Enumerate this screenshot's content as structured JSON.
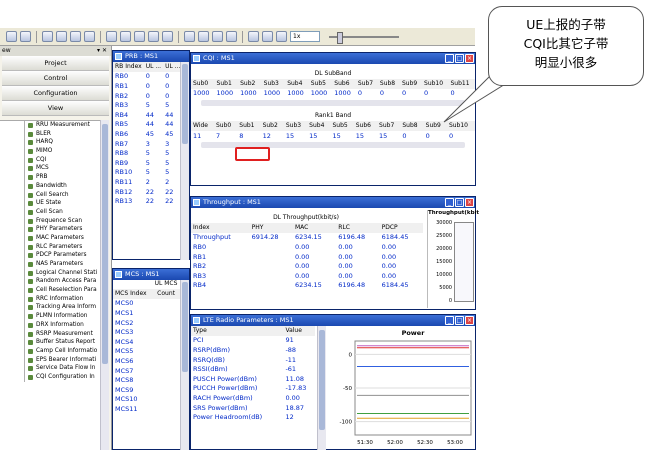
{
  "left_panel": {
    "header": "ew",
    "header_ctrl": "▾ ✕",
    "buttons": [
      "Project",
      "Control",
      "Configuration",
      "View"
    ],
    "tree": [
      "RRU Measurement",
      "BLER",
      "HARQ",
      "MIMO",
      "CQI",
      "MCS",
      "PRB",
      "Bandwidth",
      "Cell Search",
      "UE State",
      "Cell Scan",
      "Frequence Scan",
      "PHY Parameters",
      "MAC Parameters",
      "RLC Parameters",
      "PDCP Parameters",
      "NAS Parameters",
      "Logical Channel Stati",
      "Random Access Para",
      "Cell Reselection Para",
      "RRC Information",
      "Tracking Area Inform",
      "PLMN Information",
      "DRX Information",
      "RSRP Measurement",
      "Buffer Status Report",
      "Camp Cell Informatio",
      "EPS Bearer Informati",
      "Service Data Flow In",
      "CQI Configuration In"
    ]
  },
  "toolbar": {
    "zoom": "1x"
  },
  "prb": {
    "title": "PRB : MS1",
    "headers": [
      "RB Index",
      "UL ...",
      "UL ..."
    ],
    "rows": [
      [
        "RB0",
        "0",
        "0"
      ],
      [
        "RB1",
        "0",
        "0"
      ],
      [
        "RB2",
        "0",
        "0"
      ],
      [
        "RB3",
        "5",
        "5"
      ],
      [
        "RB4",
        "44",
        "44"
      ],
      [
        "RB5",
        "44",
        "44"
      ],
      [
        "RB6",
        "45",
        "45"
      ],
      [
        "RB7",
        "3",
        "3"
      ],
      [
        "RB8",
        "5",
        "5"
      ],
      [
        "RB9",
        "5",
        "5"
      ],
      [
        "RB10",
        "5",
        "5"
      ],
      [
        "RB11",
        "2",
        "2"
      ],
      [
        "RB12",
        "22",
        "22"
      ],
      [
        "RB13",
        "22",
        "22"
      ]
    ]
  },
  "mcs": {
    "title": "MCS : MS1",
    "group": "UL MCS",
    "headers": [
      "MCS Index",
      "Count"
    ],
    "rows": [
      "MCS0",
      "MCS1",
      "MCS2",
      "MCS3",
      "MCS4",
      "MCS5",
      "MCS6",
      "MCS7",
      "MCS8",
      "MCS9",
      "MCS10",
      "MCS11"
    ]
  },
  "cqi": {
    "title": "CQI : MS1",
    "subband_title": "DL SubBand",
    "sub_headers": [
      "Sub0",
      "Sub1",
      "Sub2",
      "Sub3",
      "Sub4",
      "Sub5",
      "Sub6",
      "Sub7",
      "Sub8",
      "Sub9",
      "Sub10",
      "Sub11"
    ],
    "sub_values": [
      "1000",
      "1000",
      "1000",
      "1000",
      "1000",
      "1000",
      "1000",
      "0",
      "0",
      "0",
      "0",
      "0"
    ],
    "rank_title": "Rank1 Band",
    "rank_headers": [
      "Wide",
      "Sub0",
      "Sub1",
      "Sub2",
      "Sub3",
      "Sub4",
      "Sub5",
      "Sub6",
      "Sub7",
      "Sub8",
      "Sub9",
      "Sub10"
    ],
    "rank_values": [
      "11",
      "7",
      "8",
      "12",
      "15",
      "15",
      "15",
      "15",
      "15",
      "0",
      "0",
      "0"
    ]
  },
  "throughput": {
    "title": "Throughput : MS1",
    "group": "DL Throughput(kbit/s)",
    "headers": [
      "Index",
      "PHY",
      "MAC",
      "RLC",
      "PDCP"
    ],
    "rows": [
      [
        "Throughput",
        "6914.28",
        "6234.15",
        "6196.48",
        "6184.45"
      ],
      [
        "RB0",
        "",
        "0.00",
        "0.00",
        "0.00"
      ],
      [
        "RB1",
        "",
        "0.00",
        "0.00",
        "0.00"
      ],
      [
        "RB2",
        "",
        "0.00",
        "0.00",
        "0.00"
      ],
      [
        "RB3",
        "",
        "0.00",
        "0.00",
        "0.00"
      ],
      [
        "RB4",
        "",
        "6234.15",
        "6196.48",
        "6184.45"
      ]
    ],
    "chart_title": "Throughput(kbit",
    "yticks": [
      "30000",
      "25000",
      "20000",
      "15000",
      "10000",
      "5000",
      "0"
    ]
  },
  "radio": {
    "title": "LTE Radio Parameters : MS1",
    "headers": [
      "Type",
      "Value"
    ],
    "rows": [
      [
        "PCI",
        "91"
      ],
      [
        "RSRP(dBm)",
        "-88"
      ],
      [
        "RSRQ(dB)",
        "-11"
      ],
      [
        "RSSI(dBm)",
        "-61"
      ],
      [
        "PUSCH Power(dBm)",
        "11.08"
      ],
      [
        "PUCCH Power(dBm)",
        "-17.83"
      ],
      [
        "RACH Power(dBm)",
        "0.00"
      ],
      [
        "SRS Power(dBm)",
        "18.87"
      ],
      [
        "Power Headroom(dB)",
        "12"
      ]
    ]
  },
  "power": {
    "title": "Power",
    "yticks": [
      "0",
      "-50",
      "-100"
    ],
    "xticks": [
      "51:30",
      "52:00",
      "52:30",
      "53:00"
    ]
  },
  "callout": {
    "lines": [
      "UE上报的子带",
      "CQI比其它子带",
      "明显小很多"
    ]
  }
}
